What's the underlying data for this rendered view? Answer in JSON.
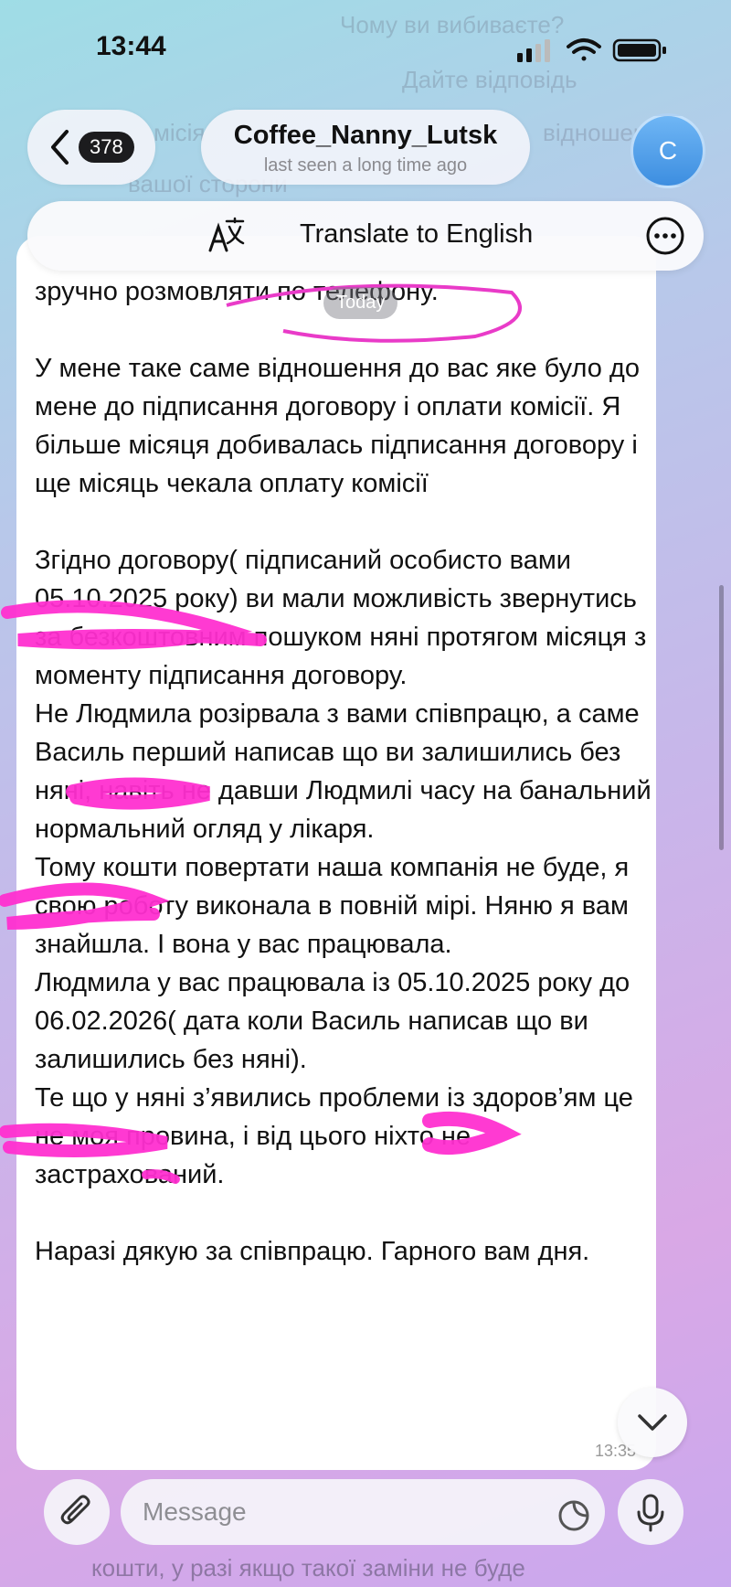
{
  "status_bar": {
    "time": "13:44"
  },
  "background_ghost": {
    "top_lines": [
      "Чому ви вибиваєте?",
      "Дайте відповідь",
      "місія",
      "вашої сторони",
      "відношен"
    ],
    "bottom_lines": [
      "кошти, у разі якщо такої заміни не буде"
    ]
  },
  "header": {
    "back_badge": "378",
    "title": "Coffee_Nanny_Lutsk",
    "subtitle": "last seen a long time ago",
    "avatar_letter": "C"
  },
  "translate_bar": {
    "label": "Translate to English"
  },
  "date_chip": "Today",
  "message": {
    "text": "зручно розмовляти по телефону.\n\nУ мене таке саме відношення до вас яке було до мене до підписання договору і оплати комісії. Я більше місяця добивалась підписання договору і ще місяць чекала оплату комісії\n\nЗгідно договору( підписаний особисто вами 05.10.2025 року) ви мали можливість звернутись за безкоштовним пошуком няні протягом місяця з моменту підписання договору.\nНе Людмила розірвала з вами співпрацю, а саме Василь перший написав що ви залишились без няні, навіть не давши Людмилі часу на банальний нормальний огляд у лікаря.\nТому кошти повертати наша компанія не буде, я свою роботу виконала в повній мірі. Няню я вам знайшла. І вона у вас працювала.\nЛюдмила у вас працювала із 05.10.2025 року до 06.02.2026( дата коли Василь написав що ви залишились без няні).\nТе що у няні з’явились проблеми із здоров’ям це не моя провина, і від цього ніхто не застрахований.\n\nНаразі дякую за співпрацю. Гарного вам дня.",
    "time": "13:35"
  },
  "composer": {
    "placeholder": "Message"
  },
  "colors": {
    "redaction": "#ff2fd0",
    "badge": "#1c1c1e",
    "avatar": "#4b9be8"
  }
}
